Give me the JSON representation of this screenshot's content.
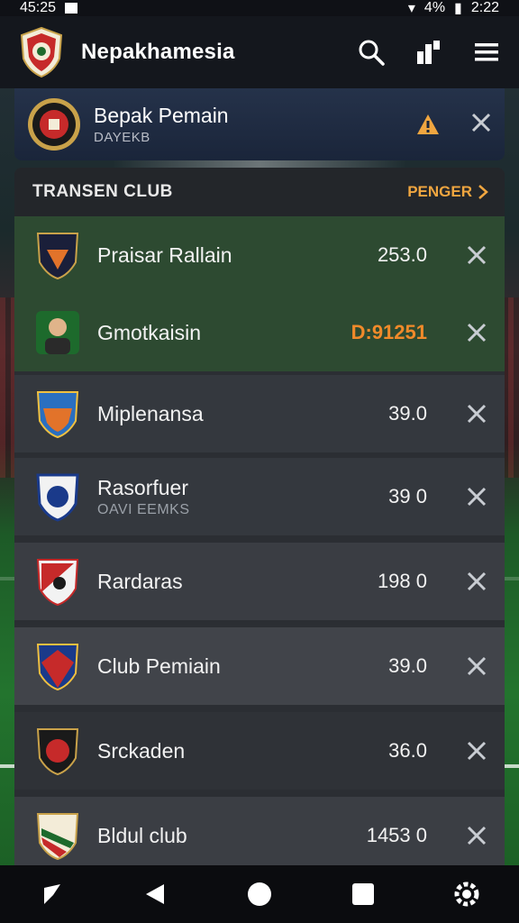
{
  "status_bar": {
    "time_left": "45:25",
    "battery": "4%",
    "time_right": "2:22"
  },
  "app_bar": {
    "title": "Nepakhamesia"
  },
  "top_card": {
    "name": "Bepak Pemain",
    "subtitle": "DAYEKB"
  },
  "panel": {
    "title": "TRANSEN CLUB",
    "link_label": "PENGER"
  },
  "rows": [
    {
      "name": "Praisar Rallain",
      "value": "253.0",
      "highlight": true
    },
    {
      "name": "Gmotkaisin",
      "value": "D:91251",
      "highlight": true,
      "value_color": "orange"
    },
    {
      "name": "Miplenansa",
      "value": "39.0"
    },
    {
      "name": "Rasorfuer",
      "subtitle": "OAVI EEMKS",
      "value": "39 0"
    },
    {
      "name": "Rardaras",
      "value": "198 0"
    },
    {
      "name": "Club Pemiain",
      "value": "39.0"
    },
    {
      "name": "Srckaden",
      "value": "36.0"
    },
    {
      "name": "Bldul club",
      "value": "1453 0"
    }
  ],
  "colors": {
    "accent": "#f0a640",
    "value_highlight": "#f08a2a",
    "highlight_row": "#2d4a31"
  },
  "icons": [
    "club-crest-icon",
    "search-icon",
    "stats-icon",
    "menu-icon",
    "alert-icon",
    "close-cross-icon",
    "back-icon",
    "home-icon",
    "recents-icon",
    "settings-icon"
  ]
}
